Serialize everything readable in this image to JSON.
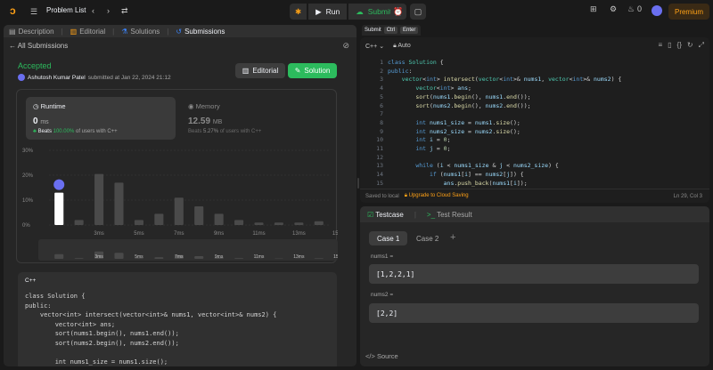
{
  "topbar": {
    "problem_list": "Problem List",
    "run": "Run",
    "submit": "Submit",
    "streak": "0",
    "premium": "Premium"
  },
  "left_tabs": [
    "Description",
    "Editorial",
    "Solutions",
    "Submissions"
  ],
  "submission": {
    "back": "All Submissions",
    "status": "Accepted",
    "author": "Ashutosh Kumar Patel",
    "submitted_at": "submitted at Jan 22, 2024 21:12",
    "editorial_btn": "Editorial",
    "solution_btn": "Solution"
  },
  "runtime": {
    "label": "Runtime",
    "value": "0",
    "unit": "ms",
    "beats_prefix": "Beats",
    "beats_pct": "100.00%",
    "beats_suffix": "of users with C++"
  },
  "memory": {
    "label": "Memory",
    "value": "12.59",
    "unit": "MB",
    "beats_prefix": "Beats",
    "beats_pct": "5.27%",
    "beats_suffix": "of users with C++"
  },
  "chart_data": {
    "type": "bar",
    "y_ticks": [
      "30%",
      "20%",
      "10%",
      "0%"
    ],
    "ylim": [
      0,
      30
    ],
    "x_ticks": [
      "3ms",
      "5ms",
      "7ms",
      "9ms",
      "11ms",
      "13ms",
      "15ms"
    ],
    "values": [
      13,
      2,
      20.5,
      17,
      2,
      4.5,
      11,
      7.5,
      4.5,
      2,
      1,
      1,
      1,
      1.5
    ],
    "highlight_index": 0,
    "colors": {
      "highlight": "#ffffff",
      "bar": "#4a4a4a",
      "grid": "#3a3a3a"
    }
  },
  "submitted_code": {
    "lang": "C++",
    "lines": [
      "class Solution {",
      "public:",
      "    vector<int> intersect(vector<int>& nums1, vector<int>& nums2) {",
      "        vector<int> ans;",
      "        sort(nums1.begin(), nums1.end());",
      "        sort(nums2.begin(), nums2.end());",
      "",
      "        int nums1_size = nums1.size();"
    ]
  },
  "submit_shortcut": {
    "label": "Submit",
    "k1": "Ctrl",
    "k2": "Enter"
  },
  "editor": {
    "lang": "C++",
    "mode": "Auto",
    "saved": "Saved to local",
    "upgrade": "Upgrade to Cloud Saving",
    "cursor": "Ln 29, Col 3",
    "line_numbers": [
      "1",
      "2",
      "3",
      "4",
      "5",
      "6",
      "7",
      "8",
      "9",
      "10",
      "11",
      "12",
      "13",
      "14",
      "15"
    ]
  },
  "testcase": {
    "tab1": "Testcase",
    "tab2": "Test Result",
    "case1": "Case 1",
    "case2": "Case 2",
    "var1_label": "nums1 =",
    "var1_value": "[1,2,2,1]",
    "var2_label": "nums2 =",
    "var2_value": "[2,2]",
    "source": "Source"
  }
}
